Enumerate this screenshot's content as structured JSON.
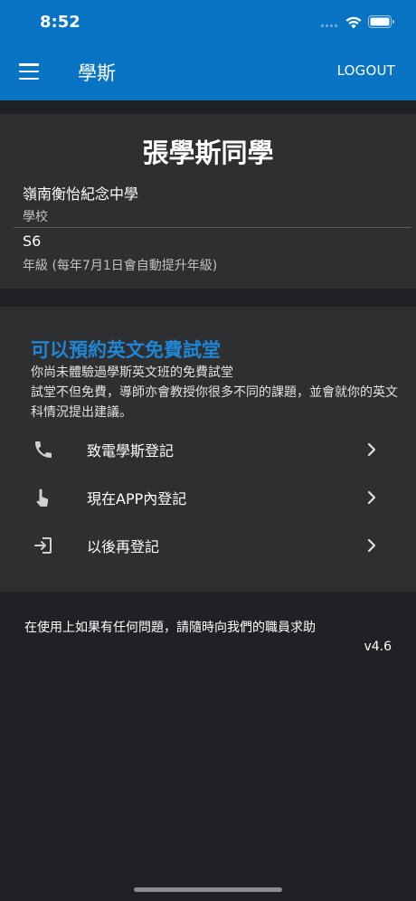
{
  "status_bar": {
    "time": "8:52"
  },
  "appbar": {
    "title": "學斯",
    "logout_label": "LOGOUT",
    "color": "#0a74c4"
  },
  "profile": {
    "name": "張學斯同學",
    "school_value": "嶺南衡怡紀念中學",
    "school_label": "學校",
    "grade_value": "S6",
    "grade_label": "年級 (每年7月1日會自動提升年級)"
  },
  "trial": {
    "title": "可以預約英文免費試堂",
    "description_line1": "你尚未體驗過學斯英文班的免費試堂",
    "description_line2": "試堂不但免費，導師亦會教授你很多不同的課題，並會就你的英文科情況提出建議。",
    "accent_color": "#1f86d6",
    "options": [
      {
        "label": "致電學斯登記",
        "icon": "phone-icon"
      },
      {
        "label": "現在APP內登記",
        "icon": "touch-icon"
      },
      {
        "label": "以後再登記",
        "icon": "login-icon"
      }
    ]
  },
  "footer": {
    "help_text": "在使用上如果有任何問題，請隨時向我們的職員求助",
    "version": "v4.6"
  }
}
